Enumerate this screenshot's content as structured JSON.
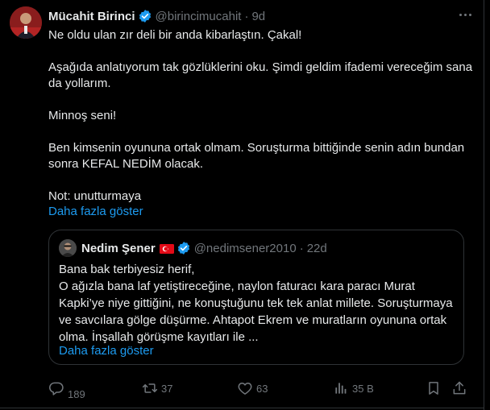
{
  "tweet": {
    "author_name": "Mücahit Birinci",
    "handle": "@birincimucahit",
    "separator": "·",
    "time": "9d",
    "paragraphs": [
      "Ne oldu ulan zır deli bir anda kibarlaştın. Çakal!",
      "Aşağıda anlatıyorum tak gözlüklerini oku. Şimdi geldim ifademi vereceğim sana da yollarım.",
      "Minnoş seni!",
      "Ben kimsenin oyununa ortak olmam. Soruşturma bittiğinde senin adın bundan sonra KEFAL NEDİM olacak.",
      "Not: unutturmaya"
    ],
    "show_more": "Daha fazla göster"
  },
  "quoted": {
    "author_name": "Nedim Şener",
    "handle": "@nedimsener2010",
    "separator": "·",
    "time": "22d",
    "lines": [
      "Bana bak terbiyesiz herif,",
      "O ağızla bana laf yetiştireceğine, naylon faturacı kara paracı Murat Kapki’ye niye gittiğini, ne konuştuğunu tek tek anlat millete. Soruşturmaya ve savcılara gölge düşürme. Ahtapot Ekrem ve muratların oyununa ortak olma. İnşallah görüşme kayıtları ile ..."
    ],
    "show_more": "Daha fazla göster"
  },
  "actions": {
    "replies": "189",
    "reposts": "37",
    "likes": "63",
    "views": "35 B"
  },
  "icons": [
    "verified-badge-icon",
    "more-icon",
    "turkish-flag-icon",
    "reply-icon",
    "repost-icon",
    "like-icon",
    "views-icon",
    "bookmark-icon",
    "share-icon"
  ],
  "colors": {
    "background": "#000000",
    "text": "#e7e9ea",
    "muted": "#71767b",
    "link": "#1d9bf0",
    "border": "#2f3336"
  }
}
